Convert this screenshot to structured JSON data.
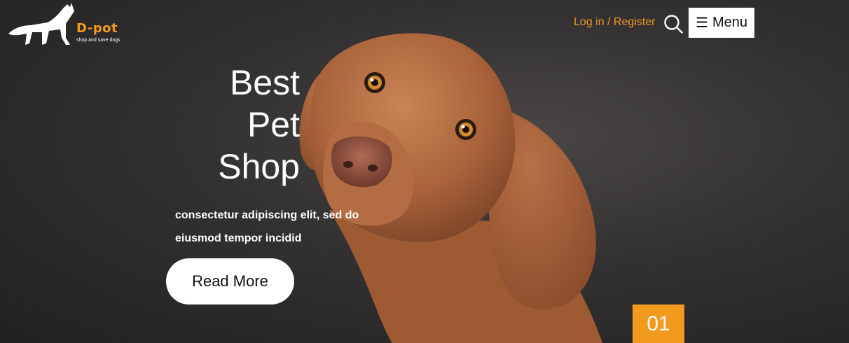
{
  "brand": {
    "name": "D-pot",
    "tagline": "shop and save dogs"
  },
  "header": {
    "login_label": "Log in / Register",
    "search_icon": "search-icon",
    "menu_icon": "☰",
    "menu_label": "Menu"
  },
  "hero": {
    "headline": [
      "Best",
      "Pet",
      "Shop"
    ],
    "subtext": [
      "consectetur adipiscing elit, sed do",
      "eiusmod tempor incidid"
    ],
    "cta_label": "Read More",
    "slide_number": "01"
  },
  "colors": {
    "accent": "#f29a1e",
    "background": "#2c2a2a",
    "text": "#ffffff"
  }
}
